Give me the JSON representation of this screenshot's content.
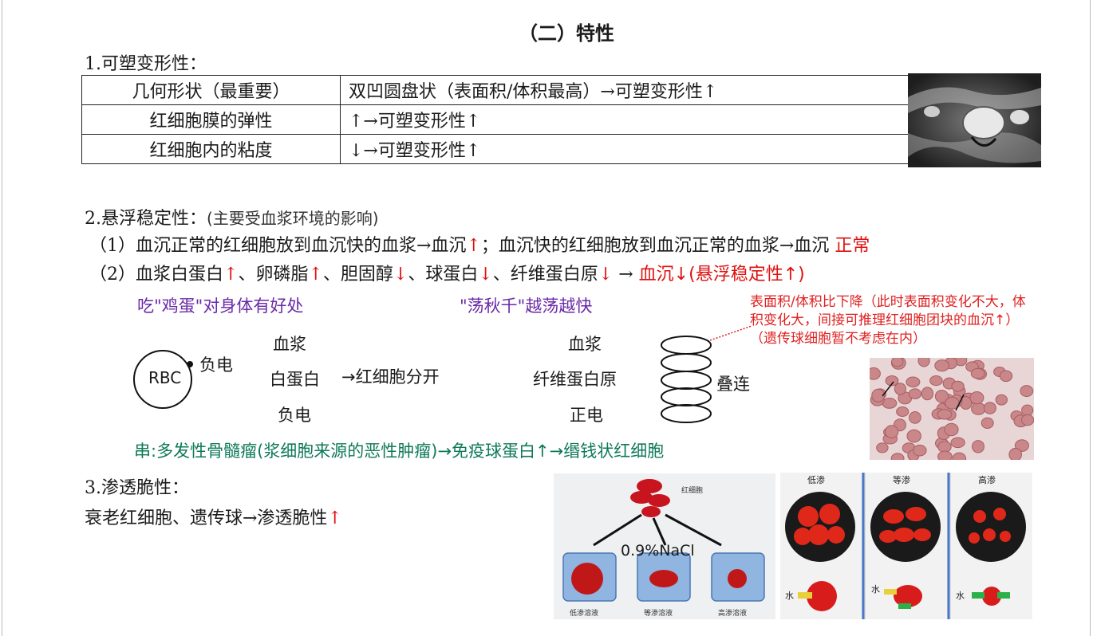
{
  "title": "（二）特性",
  "section1": {
    "heading": "1.可塑变形性：",
    "rows": [
      {
        "factor": "几何形状（最重要）",
        "effect": "双凹圆盘状（表面积/体积最高）→可塑变形性↑"
      },
      {
        "factor": "红细胞膜的弹性",
        "effect": "↑→可塑变形性↑"
      },
      {
        "factor": "红细胞内的粘度",
        "effect": "↓→可塑变形性↑"
      }
    ]
  },
  "section2": {
    "heading": "2.悬浮稳定性：",
    "heading_note": "(主要受血浆环境的影响)",
    "line1_text": "（1）血沉正常的红细胞放到血沉快的血浆→血沉",
    "line1_arrow": "↑",
    "line1_text2": "；血沉快的红细胞放到血沉正常的血浆→血沉 ",
    "line1_end": "正常",
    "line2_prefix": "（2）血浆白蛋白",
    "line2_a1": "↑",
    "line2_t2": "、卵磷脂",
    "line2_a2": "↑",
    "line2_t3": "、胆固醇",
    "line2_a3": "↓",
    "line2_t4": "、球蛋白",
    "line2_a4": "↓",
    "line2_t5": "、纤维蛋白原",
    "line2_a5": "↓",
    "line2_t6": " → ",
    "line2_end": "血沉↓(悬浮稳定性↑)",
    "note_left": "吃\"鸡蛋\"对身体有好处",
    "note_right": "\"荡秋千\"越荡越快",
    "rbc_label": "RBC",
    "rbc_charge": "负电",
    "col1": [
      "血浆",
      "白蛋白",
      "负电"
    ],
    "col1_arrow": "→红细胞分开",
    "col2": [
      "血浆",
      "纤维蛋白原",
      "正电"
    ],
    "stack_label": "叠连",
    "side_note": "表面积/体积比下降（此时表面积变化不大，体积变化大，间接可推理红细胞团块的血沉↑）（遗传球细胞暂不考虑在内）",
    "bottom_note": "串:多发性骨髓瘤(浆细胞来源的恶性肿瘤)→免疫球蛋白↑→缗钱状红细胞"
  },
  "section3": {
    "heading": "3.渗透脆性：",
    "text": "衰老红细胞、遗传球→渗透脆性",
    "arrow": "↑"
  },
  "figure_osmosis": {
    "rbc_label": "红细胞",
    "nacl": "0.9%NaCl",
    "beakers": [
      "低渗溶液",
      "等渗溶液",
      "高渗溶液"
    ]
  },
  "figure_panels": {
    "labels": [
      "低渗",
      "等渗",
      "高渗"
    ],
    "water": "水"
  }
}
